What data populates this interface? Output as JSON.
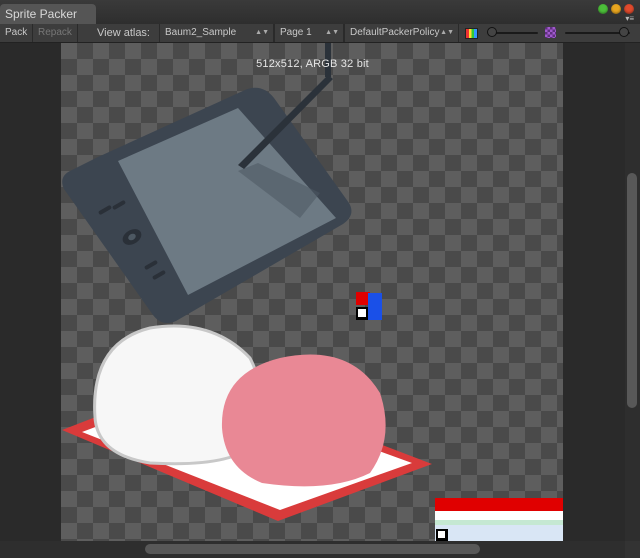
{
  "window": {
    "tab_title": "Sprite Packer",
    "controls": [
      {
        "name": "maximize-button",
        "color": "#4cbf3a"
      },
      {
        "name": "minimize-button",
        "color": "#e8a620"
      },
      {
        "name": "close-button",
        "color": "#e04a2d"
      }
    ],
    "menu_icon": "context-menu-icon"
  },
  "toolbar": {
    "pack_label": "Pack",
    "repack_label": "Repack",
    "view_atlas_label": "View atlas:",
    "atlas_value": "Baum2_Sample",
    "page_value": "Page 1",
    "policy_value": "DefaultPackerPolicy",
    "color_channel_icon": "rgb-channel-icon",
    "mip_icon": "mipmap-icon",
    "zoom_level": 0,
    "mip_level": 0
  },
  "canvas": {
    "atlas_info": "512x512, ARGB 32 bit",
    "sprites": [
      "pen-tablet-sprite",
      "color-square-sprite",
      "mochi-sprite",
      "ui-panel-sprite"
    ]
  },
  "scroll": {
    "vertical_position": 0.45,
    "horizontal_position": 0.5
  }
}
